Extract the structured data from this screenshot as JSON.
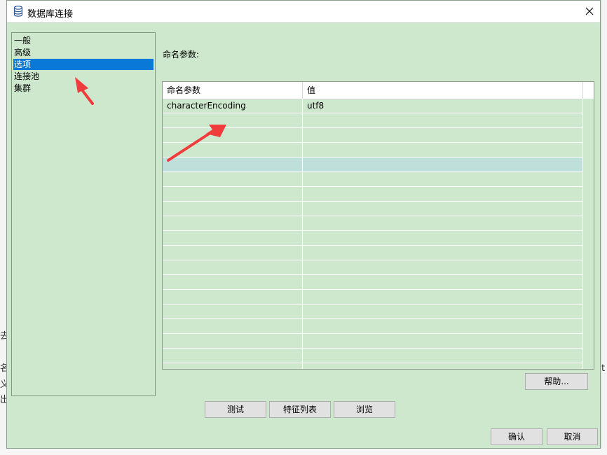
{
  "window": {
    "title": "数据库连接"
  },
  "nav": {
    "items": [
      {
        "label": "一般",
        "selected": false
      },
      {
        "label": "高级",
        "selected": false
      },
      {
        "label": "选项",
        "selected": true
      },
      {
        "label": "连接池",
        "selected": false
      },
      {
        "label": "集群",
        "selected": false
      }
    ]
  },
  "options": {
    "section_label": "命名参数:",
    "table": {
      "headers": [
        "命名参数",
        "值"
      ],
      "rows": [
        {
          "name": "characterEncoding",
          "value": "utf8"
        }
      ],
      "highlighted_row_index": 4
    }
  },
  "buttons": {
    "help": "帮助...",
    "test": "测试",
    "feature_list": "特征列表",
    "browse": "浏览",
    "ok": "确认",
    "cancel": "取消"
  },
  "background_fragments": [
    "去",
    "名",
    "义",
    "出",
    "t"
  ],
  "colors": {
    "dialog_bg": "#cde8cd",
    "selected_item": "#0a78d7",
    "highlight_row": "#bfe0da",
    "annotation_arrow": "#f03c3c"
  },
  "icons": {
    "title": "database-icon",
    "close": "close-icon",
    "annotation": "red-arrow-icon"
  }
}
